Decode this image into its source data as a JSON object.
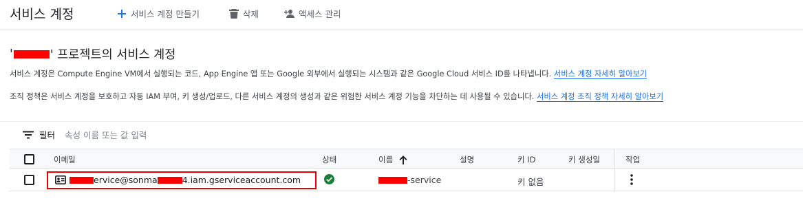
{
  "header": {
    "title": "서비스 계정",
    "create_label": "서비스 계정 만들기",
    "delete_label": "삭제",
    "manage_access_label": "액세스 관리"
  },
  "section": {
    "title_prefix": "'",
    "title_suffix": "' 프로젝트의 서비스 계정",
    "description": "서비스 계정은 Compute Engine VM에서 실행되는 코드, App Engine 앱 또는 Google 외부에서 실행되는 시스템과 같은 Google Cloud 서비스 ID를 나타냅니다.",
    "description_link": "서비스 계정 자세히 알아보기",
    "policy": "조직 정책은 서비스 계정을 보호하고 자동 IAM 부여, 키 생성/업로드, 다른 서비스 계정의 생성과 같은 위험한 서비스 계정 기능을 차단하는 데 사용될 수 있습니다.",
    "policy_link": "서비스 계정 조직 정책 자세히 알아보기"
  },
  "filter": {
    "label": "필터",
    "placeholder": "속성 이름 또는 값 입력"
  },
  "table": {
    "headers": {
      "email": "이메일",
      "status": "상태",
      "name": "이름",
      "description": "설명",
      "key_id": "키 ID",
      "key_created": "키 생성일",
      "actions": "작업"
    },
    "rows": [
      {
        "email_part1": "ervice@sonma",
        "email_part2": "4.iam.gserviceaccount.com",
        "name_suffix": "-service",
        "key_id": "키 없음",
        "status": "enabled"
      }
    ]
  },
  "colors": {
    "accent": "#1a73e8",
    "status_ok": "#188038",
    "redaction": "#ff0000",
    "highlight_border": "#e50000"
  }
}
